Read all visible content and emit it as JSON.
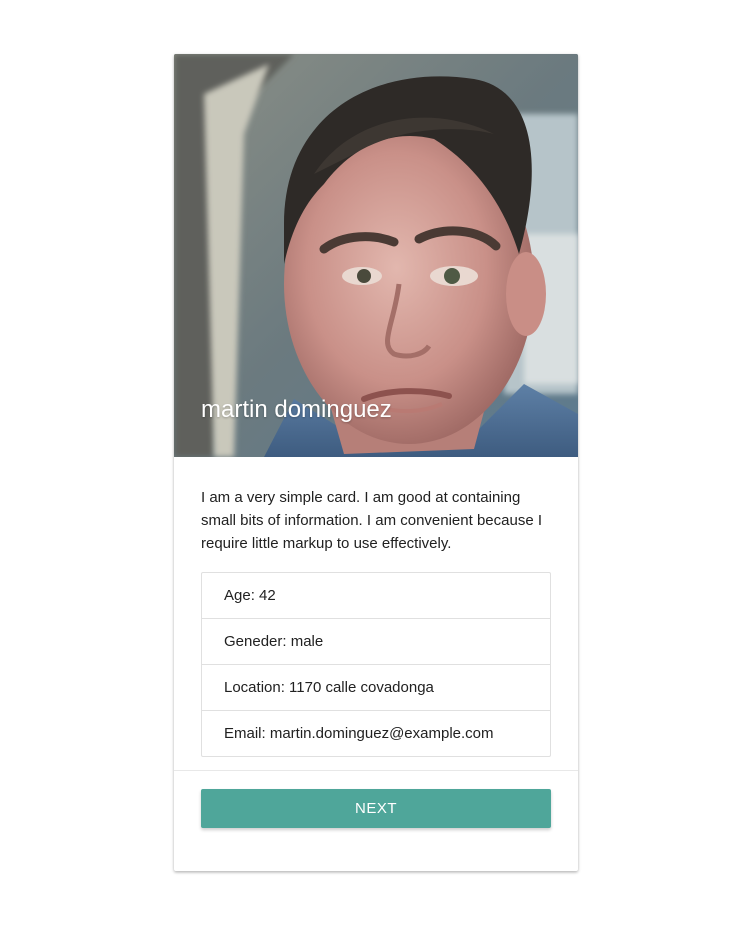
{
  "card": {
    "name": "martin dominguez",
    "description": "I am a very simple card. I am good at containing small bits of information. I am convenient because I require little markup to use effectively.",
    "details": {
      "age": "Age: 42",
      "gender": "Geneder: male",
      "location": "Location: 1170 calle covadonga",
      "email": "Email: martin.dominguez@example.com"
    },
    "next_label": "NEXT"
  },
  "colors": {
    "button": "#4fa69a",
    "divider": "#e0e0e0",
    "title_text": "#ffffff"
  }
}
